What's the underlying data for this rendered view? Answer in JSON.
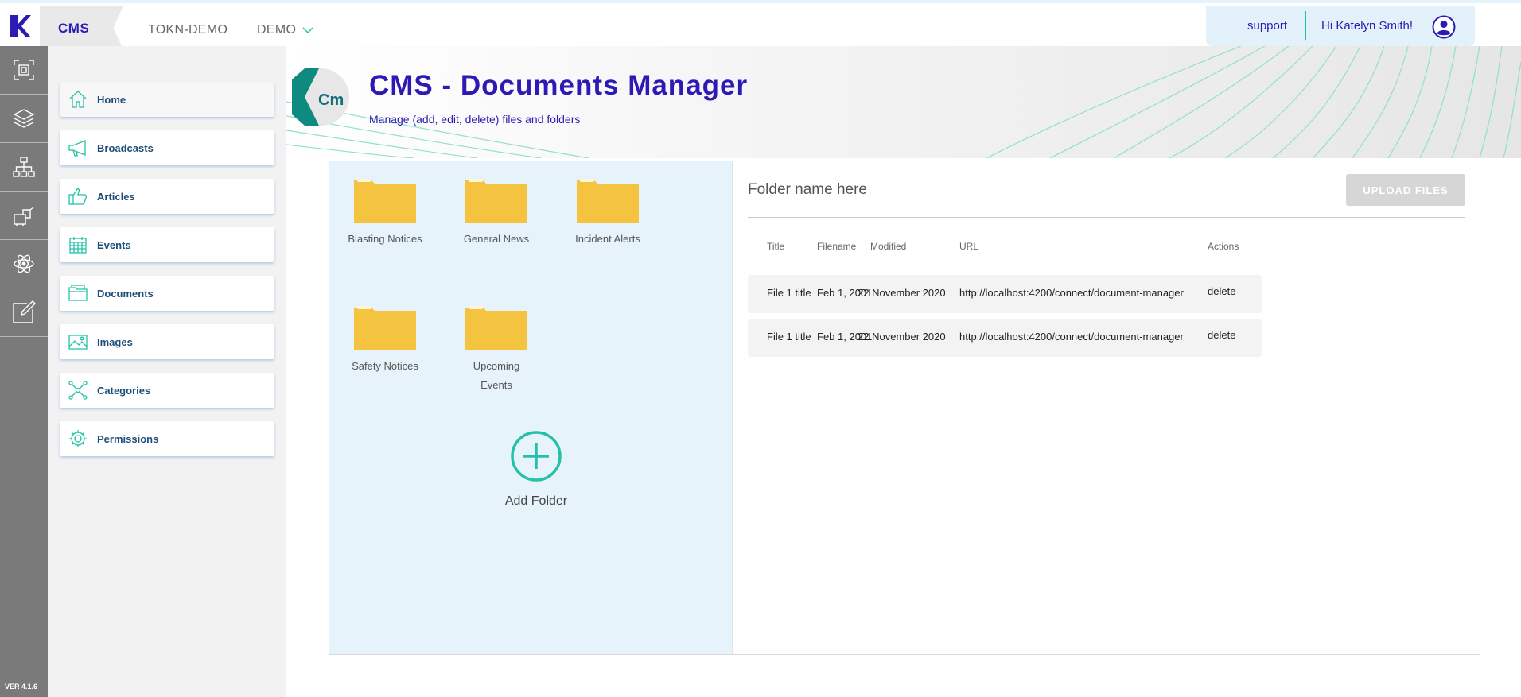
{
  "app": {
    "logo_icon": "k-logo-icon",
    "module_label": "CMS",
    "breadcrumbs": [
      "TOKN-DEMO",
      "DEMO"
    ],
    "version": "VER 4.1.6",
    "accent_color": "#2b1ab3",
    "teal_color": "#23c2a7"
  },
  "user": {
    "support_label": "support",
    "greeting": "Hi Katelyn Smith!",
    "avatar_icon": "user-circle-icon"
  },
  "rail": {
    "items": [
      {
        "icon": "scan-icon"
      },
      {
        "icon": "layers-icon"
      },
      {
        "icon": "org-chart-icon"
      },
      {
        "icon": "machine-icon"
      },
      {
        "icon": "atom-icon"
      },
      {
        "icon": "edit-icon"
      }
    ]
  },
  "sidebar": {
    "items": [
      {
        "label": "Home",
        "icon": "home-icon"
      },
      {
        "label": "Broadcasts",
        "icon": "megaphone-icon"
      },
      {
        "label": "Articles",
        "icon": "thumbs-up-icon"
      },
      {
        "label": "Events",
        "icon": "calendar-icon"
      },
      {
        "label": "Documents",
        "icon": "folder-icon"
      },
      {
        "label": "Images",
        "icon": "image-icon"
      },
      {
        "label": "Categories",
        "icon": "network-icon"
      },
      {
        "label": "Permissions",
        "icon": "gear-icon"
      }
    ]
  },
  "header": {
    "logo_text": "Cm",
    "title": "CMS - Documents Manager",
    "subtitle": "Manage (add, edit, delete) files and folders"
  },
  "folders": {
    "items": [
      {
        "label": "Blasting Notices"
      },
      {
        "label": "General News"
      },
      {
        "label": "Incident Alerts"
      },
      {
        "label": "Safety Notices"
      },
      {
        "label": "Upcoming Events"
      }
    ],
    "add_label": "Add Folder"
  },
  "files": {
    "folder_name_placeholder": "Folder name here",
    "upload_label": "UPLOAD FILES",
    "columns": [
      "Title",
      "Filename",
      "Modified",
      "URL",
      "Actions"
    ],
    "rows": [
      {
        "title": "File 1 title",
        "filename": "Feb 1, 2001",
        "modified": "22 November 2020",
        "url": "http://localhost:4200/connect/document-manager",
        "action": "delete"
      },
      {
        "title": "File 1 title",
        "filename": "Feb 1, 2001",
        "modified": "22 November 2020",
        "url": "http://localhost:4200/connect/document-manager",
        "action": "delete"
      }
    ]
  }
}
